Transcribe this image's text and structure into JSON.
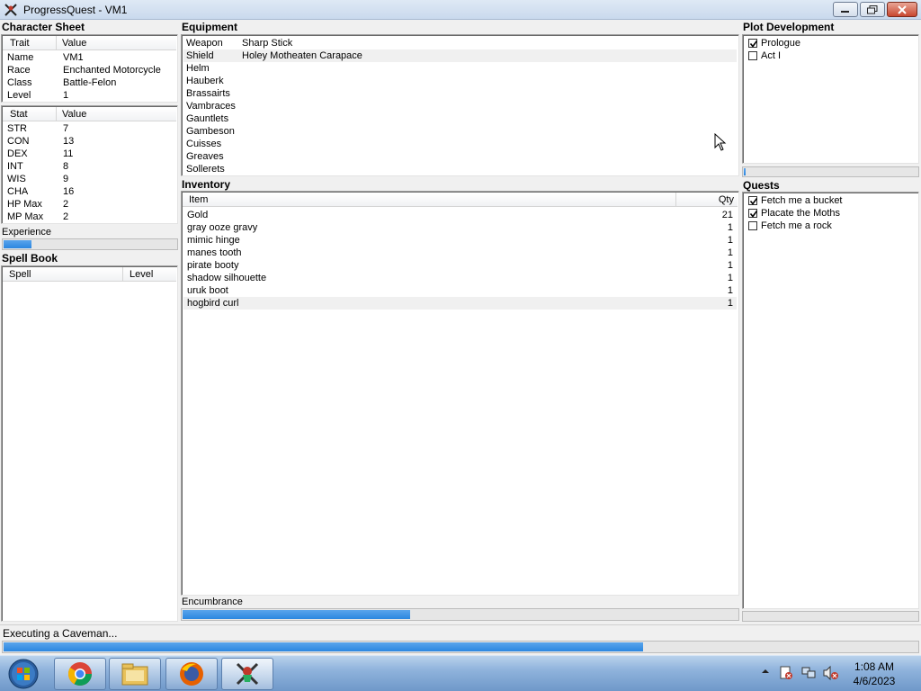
{
  "window": {
    "title": "ProgressQuest - VM1"
  },
  "character_sheet": {
    "title": "Character Sheet",
    "traits_header": [
      "Trait",
      "Value"
    ],
    "traits": [
      {
        "label": "Name",
        "value": "VM1"
      },
      {
        "label": "Race",
        "value": "Enchanted Motorcycle"
      },
      {
        "label": "Class",
        "value": "Battle-Felon"
      },
      {
        "label": "Level",
        "value": "1"
      }
    ],
    "stats_header": [
      "Stat",
      "Value"
    ],
    "stats": [
      {
        "label": "STR",
        "value": "7"
      },
      {
        "label": "CON",
        "value": "13"
      },
      {
        "label": "DEX",
        "value": "11"
      },
      {
        "label": "INT",
        "value": "8"
      },
      {
        "label": "WIS",
        "value": "9"
      },
      {
        "label": "CHA",
        "value": "16"
      },
      {
        "label": "HP Max",
        "value": "2"
      },
      {
        "label": "MP Max",
        "value": "2"
      }
    ],
    "experience_label": "Experience",
    "experience_progress": 0.16
  },
  "spell_book": {
    "title": "Spell Book",
    "header": [
      "Spell",
      "Level"
    ]
  },
  "equipment": {
    "title": "Equipment",
    "items": [
      {
        "slot": "Weapon",
        "item": "Sharp Stick"
      },
      {
        "slot": "Shield",
        "item": "Holey Motheaten Carapace"
      },
      {
        "slot": "Helm",
        "item": ""
      },
      {
        "slot": "Hauberk",
        "item": ""
      },
      {
        "slot": "Brassairts",
        "item": ""
      },
      {
        "slot": "Vambraces",
        "item": ""
      },
      {
        "slot": "Gauntlets",
        "item": ""
      },
      {
        "slot": "Gambeson",
        "item": ""
      },
      {
        "slot": "Cuisses",
        "item": ""
      },
      {
        "slot": "Greaves",
        "item": ""
      },
      {
        "slot": "Sollerets",
        "item": ""
      }
    ]
  },
  "inventory": {
    "title": "Inventory",
    "header": [
      "Item",
      "Qty"
    ],
    "items": [
      {
        "name": "Gold",
        "qty": "21"
      },
      {
        "name": "gray ooze gravy",
        "qty": "1"
      },
      {
        "name": "mimic hinge",
        "qty": "1"
      },
      {
        "name": "manes tooth",
        "qty": "1"
      },
      {
        "name": "pirate booty",
        "qty": "1"
      },
      {
        "name": "shadow silhouette",
        "qty": "1"
      },
      {
        "name": "uruk boot",
        "qty": "1"
      },
      {
        "name": "hogbird curl",
        "qty": "1"
      }
    ],
    "encumbrance_label": "Encumbrance",
    "encumbrance_progress": 0.41
  },
  "plot": {
    "title": "Plot Development",
    "acts": [
      {
        "label": "Prologue",
        "checked": true
      },
      {
        "label": "Act I",
        "checked": false
      }
    ]
  },
  "quests": {
    "title": "Quests",
    "items": [
      {
        "label": "Fetch me a bucket",
        "checked": true
      },
      {
        "label": "Placate the Moths",
        "checked": true
      },
      {
        "label": "Fetch me a rock",
        "checked": false
      }
    ]
  },
  "status": {
    "text": "Executing a Caveman...",
    "progress": 0.7
  },
  "taskbar": {
    "apps": [
      "chrome",
      "file-explorer",
      "firefox",
      "progressquest"
    ],
    "time": "1:08 AM",
    "date": "4/6/2023"
  },
  "colors": {
    "progress": "#2b86e0",
    "taskbar": "#8fb3dc"
  }
}
